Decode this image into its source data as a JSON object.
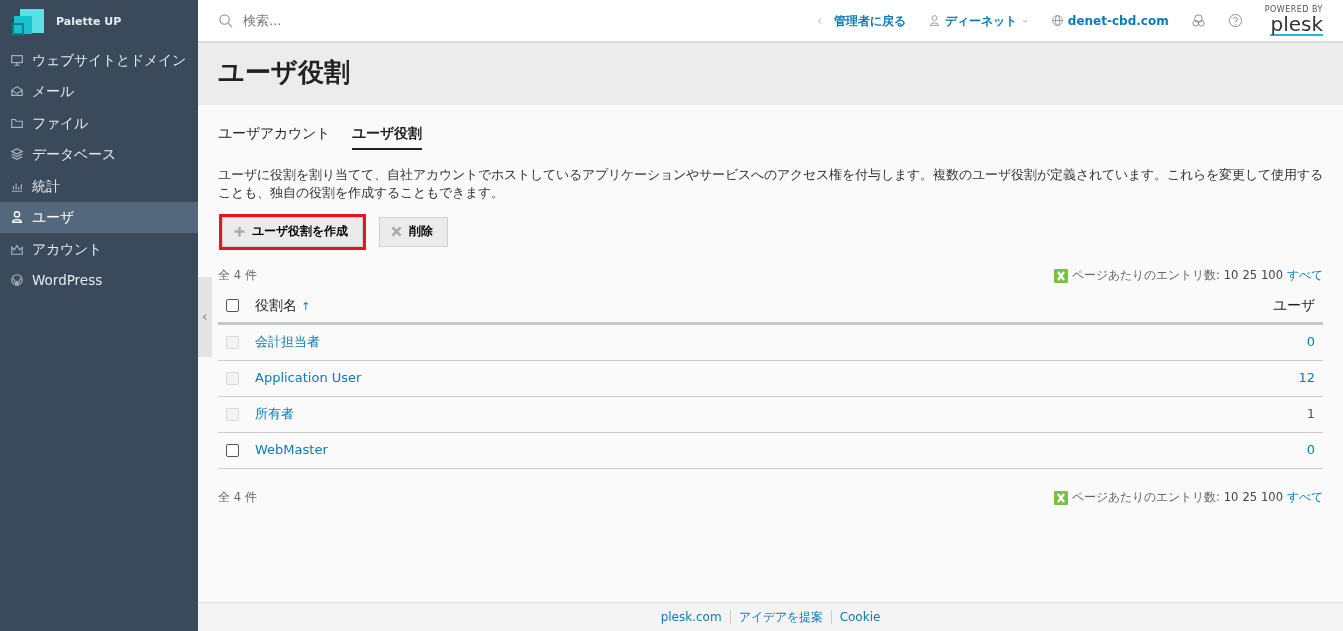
{
  "sidebar": {
    "brand": "Palette UP",
    "items": [
      {
        "label": "ウェブサイトとドメイン",
        "selected": false
      },
      {
        "label": "メール",
        "selected": false
      },
      {
        "label": "ファイル",
        "selected": false
      },
      {
        "label": "データベース",
        "selected": false
      },
      {
        "label": "統計",
        "selected": false
      },
      {
        "label": "ユーザ",
        "selected": true
      },
      {
        "label": "アカウント",
        "selected": false
      },
      {
        "label": "WordPress",
        "selected": false
      }
    ]
  },
  "header": {
    "search": {
      "placeholder": "検索..."
    },
    "back_link": "管理者に戻る",
    "user_menu": "ディーネット",
    "domain": "denet-cbd.com",
    "powered_by": "POWERED BY",
    "brand": "plesk"
  },
  "page_title": "ユーザ役割",
  "tabs": [
    {
      "label": "ユーザアカウント",
      "selected": false
    },
    {
      "label": "ユーザ役割",
      "selected": true
    }
  ],
  "description": "ユーザに役割を割り当てて、自社アカウントでホストしているアプリケーションやサービスへのアクセス権を付与します。複数のユーザ役割が定義されています。これらを変更して使用することも、独自の役割を作成することもできます。",
  "toolbar": [
    {
      "label": "ユーザ役割を作成",
      "highlighted": true
    },
    {
      "label": "削除",
      "highlighted": false
    }
  ],
  "pager_top": {
    "total": "全 4 件",
    "label": "ページあたりのエントリ数:",
    "options": [
      {
        "label": "10",
        "link": false
      },
      {
        "label": "25",
        "link": false
      },
      {
        "label": "100",
        "link": false
      },
      {
        "label": "すべて",
        "link": true
      }
    ]
  },
  "table": {
    "select_all_checked": false,
    "columns": [
      {
        "label": "役割名",
        "sort": "↑"
      },
      {
        "label": "ユーザ"
      }
    ],
    "rows": [
      {
        "name": "会計担当者",
        "users": "0",
        "users_link": true,
        "disabled": true
      },
      {
        "name": "Application User",
        "users": "12",
        "users_link": true,
        "disabled": true
      },
      {
        "name": "所有者",
        "users": "1",
        "users_link": false,
        "disabled": true
      },
      {
        "name": "WebMaster",
        "users": "0",
        "users_link": true,
        "disabled": false
      }
    ]
  },
  "pager_bottom": {
    "total": "全 4 件",
    "label": "ページあたりのエントリ数:",
    "options": [
      {
        "label": "10",
        "link": false
      },
      {
        "label": "25",
        "link": false
      },
      {
        "label": "100",
        "link": false
      },
      {
        "label": "すべて",
        "link": true
      }
    ]
  },
  "footer": [
    "plesk.com",
    "アイデアを提案",
    "Cookie"
  ]
}
